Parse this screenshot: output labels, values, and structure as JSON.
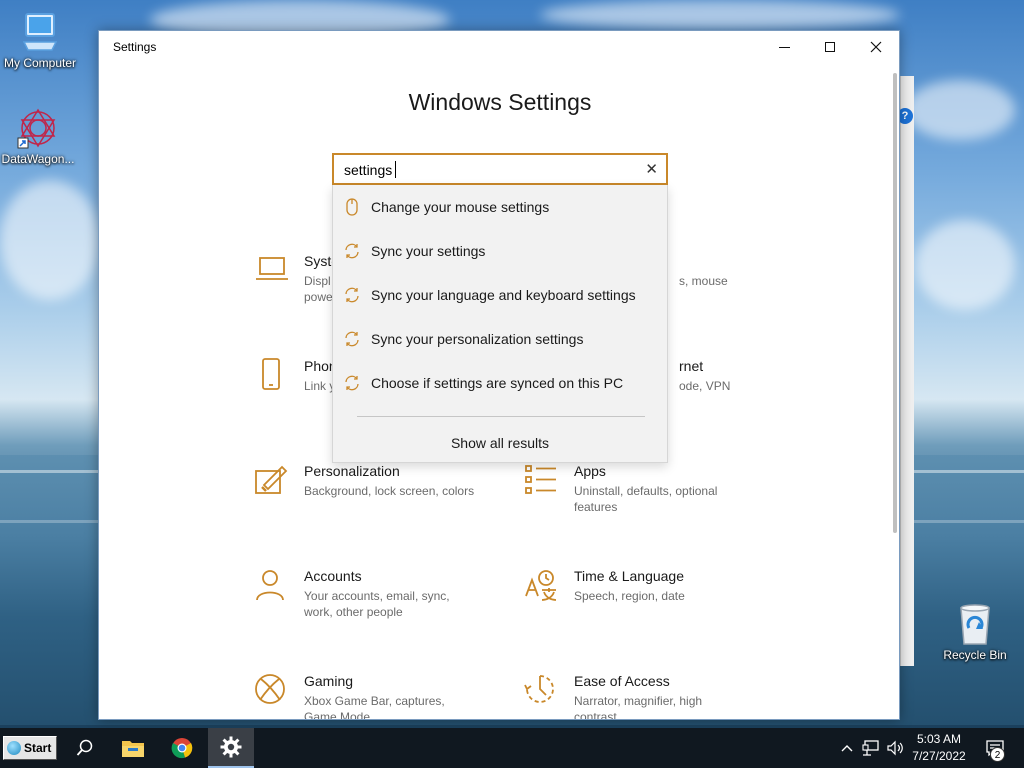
{
  "desktop": {
    "icons": [
      {
        "label": "My Computer"
      },
      {
        "label": "DataWagon..."
      },
      {
        "label": "Recycle Bin"
      }
    ]
  },
  "window": {
    "title": "Settings",
    "heading": "Windows Settings",
    "accent_color": "#c9882a",
    "search": {
      "value": "settings",
      "clear_glyph": "✕"
    },
    "results": [
      {
        "label": "Change your mouse settings",
        "icon": "mouse-icon"
      },
      {
        "label": "Sync your settings",
        "icon": "sync-icon"
      },
      {
        "label": "Sync your language and keyboard settings",
        "icon": "sync-icon"
      },
      {
        "label": "Sync your personalization settings",
        "icon": "sync-icon"
      },
      {
        "label": "Choose if settings are synced on this PC",
        "icon": "sync-icon"
      }
    ],
    "show_all": "Show all results",
    "tiles": [
      {
        "title": "Syste",
        "desc": "Displ\npowe",
        "icon": "laptop-icon"
      },
      {
        "title": "",
        "desc": "s, mouse",
        "icon": ""
      },
      {
        "title": "Phon",
        "desc": "Link y",
        "icon": "phone-icon"
      },
      {
        "title": "rnet",
        "desc": "ode, VPN",
        "icon": "globe-icon"
      },
      {
        "title": "Personalization",
        "desc": "Background, lock screen, colors",
        "icon": "paintbrush-icon"
      },
      {
        "title": "Apps",
        "desc": "Uninstall, defaults, optional features",
        "icon": "apps-list-icon"
      },
      {
        "title": "Accounts",
        "desc": "Your accounts, email, sync, work, other people",
        "icon": "person-icon"
      },
      {
        "title": "Time & Language",
        "desc": "Speech, region, date",
        "icon": "time-language-icon"
      },
      {
        "title": "Gaming",
        "desc": "Xbox Game Bar, captures, Game Mode",
        "icon": "xbox-icon"
      },
      {
        "title": "Ease of Access",
        "desc": "Narrator, magnifier, high contrast",
        "icon": "ease-of-access-icon"
      }
    ]
  },
  "taskbar": {
    "start_label": "Start",
    "time": "5:03 AM",
    "date": "7/27/2022",
    "notification_count": "2"
  }
}
